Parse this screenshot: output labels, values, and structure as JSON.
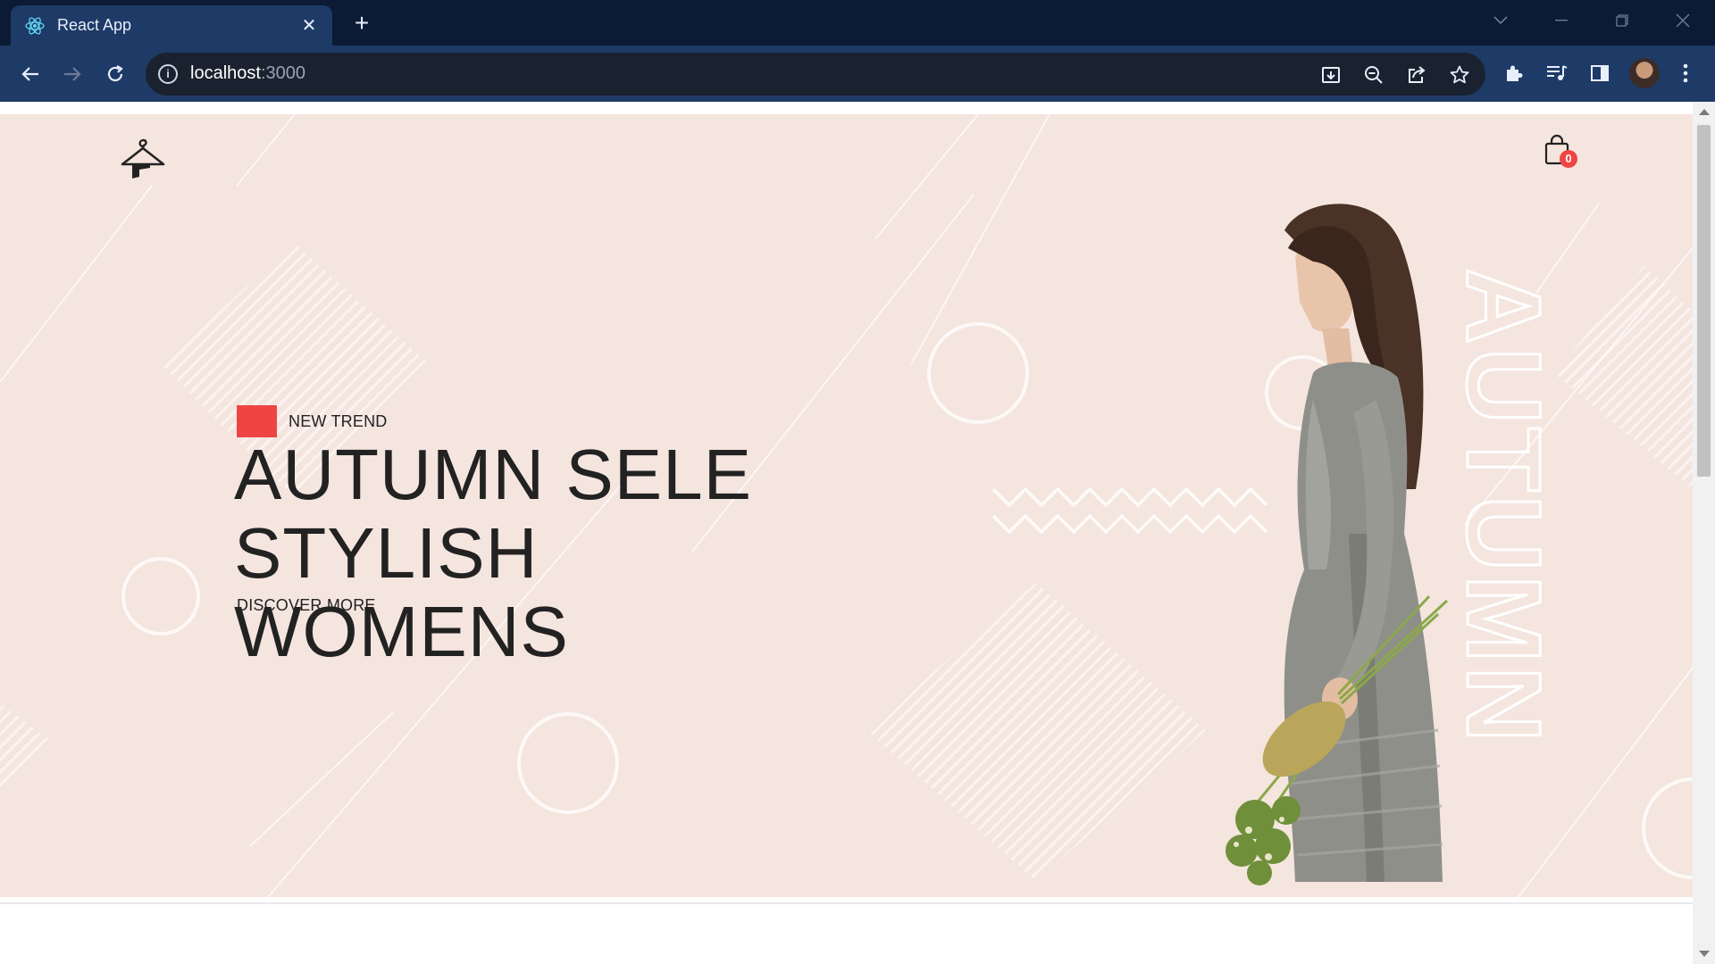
{
  "browser": {
    "tab_title": "React App",
    "tab_close": "✕",
    "new_tab": "+",
    "url_host": "localhost",
    "url_port": ":3000",
    "info_glyph": "i"
  },
  "page": {
    "hero": {
      "tag": "NEW TREND",
      "headline_line1": "AUTUMN SELE STYLISH",
      "headline_line2": "WOMENS",
      "cta": "DISCOVER MORE",
      "vertical_word": "AUTUMN"
    },
    "cart": {
      "count": "0"
    },
    "colors": {
      "accent": "#ef4444",
      "hero_bg": "#f5e5df",
      "text": "#222222"
    }
  },
  "icons": [
    "react-logo-icon",
    "close-icon",
    "plus-icon",
    "back-arrow-icon",
    "forward-arrow-icon",
    "reload-icon",
    "info-icon",
    "install-icon",
    "zoom-out-icon",
    "share-icon",
    "star-icon",
    "extensions-icon",
    "media-icon",
    "side-panel-icon",
    "menu-dots-icon",
    "hanger-logo-icon",
    "shopping-bag-icon"
  ]
}
